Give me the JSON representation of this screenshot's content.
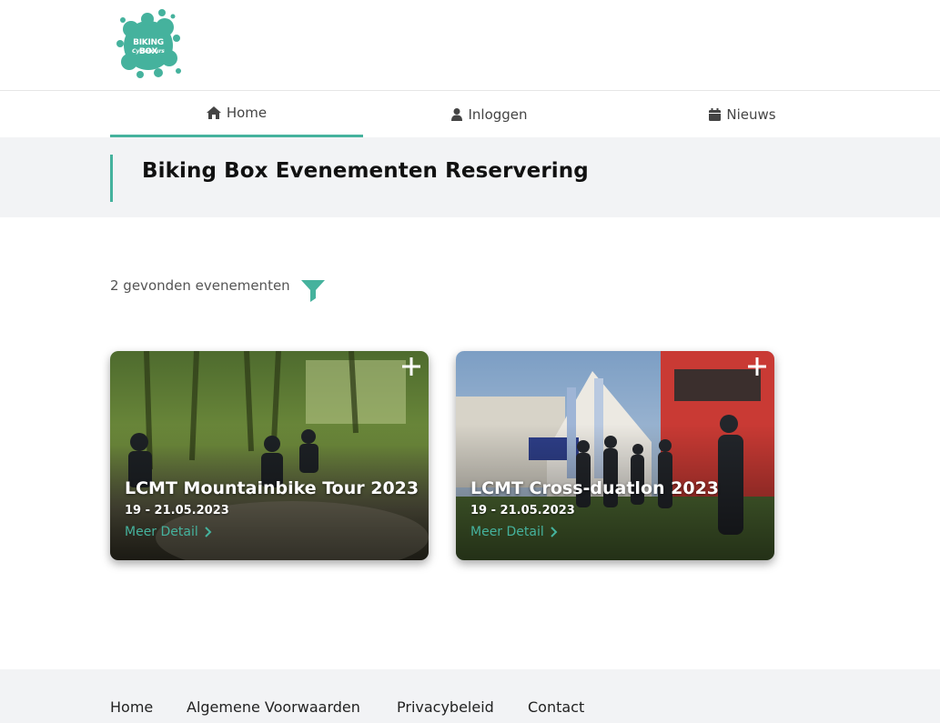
{
  "logo": {
    "line1": "BIKING BOX",
    "line2": "Cycletours",
    "icon": "paint-splash-logo",
    "color": "#45b29d"
  },
  "nav": {
    "items": [
      {
        "label": "Home",
        "icon": "home-icon",
        "active": true
      },
      {
        "label": "Inloggen",
        "icon": "user-icon",
        "active": false
      },
      {
        "label": "Nieuws",
        "icon": "calendar-icon",
        "active": false
      }
    ]
  },
  "page": {
    "title": "Biking Box Evenementen Reservering"
  },
  "results": {
    "count_text": "2 gevonden evenementen",
    "filter_icon": "filter-icon"
  },
  "events": [
    {
      "title": "LCMT Mountainbike Tour 2023",
      "date": "19 - 21.05.2023",
      "link": "Meer Detail"
    },
    {
      "title": "LCMT Cross-duatlon 2023",
      "date": "19 - 21.05.2023",
      "link": "Meer Detail"
    }
  ],
  "footer": {
    "links": [
      "Home",
      "Algemene Voorwaarden",
      "Privacybeleid",
      "Contact"
    ]
  },
  "colors": {
    "accent": "#45b29d",
    "band": "#f2f3f5"
  }
}
